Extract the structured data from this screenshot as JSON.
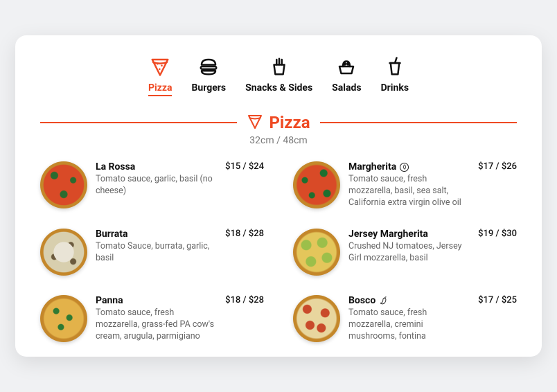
{
  "accent": "#ef4a23",
  "categories": [
    {
      "id": "pizza",
      "label": "Pizza",
      "active": true
    },
    {
      "id": "burgers",
      "label": "Burgers",
      "active": false
    },
    {
      "id": "snacks",
      "label": "Snacks & Sides",
      "active": false
    },
    {
      "id": "salads",
      "label": "Salads",
      "active": false
    },
    {
      "id": "drinks",
      "label": "Drinks",
      "active": false
    }
  ],
  "section": {
    "title": "Pizza",
    "subtitle": "32cm / 48cm"
  },
  "items": [
    {
      "name": "La Rossa",
      "desc": "Tomato sauce, garlic, basil (no cheese)",
      "price": "$15 / $24",
      "tag": null,
      "thumb": "pz-rossa"
    },
    {
      "name": "Margherita",
      "desc": "Tomato sauce, fresh mozzarella, basil, sea salt, California extra virgin olive oil",
      "price": "$17 / $26",
      "tag": "veg",
      "thumb": "pz-margh"
    },
    {
      "name": "Burrata",
      "desc": "Tomato Sauce, burrata, garlic, basil",
      "price": "$18 / $28",
      "tag": null,
      "thumb": "pz-burrata"
    },
    {
      "name": "Jersey Margherita",
      "desc": "Crushed NJ tomatoes, Jersey Girl mozzarella, basil",
      "price": "$19 / $30",
      "tag": null,
      "thumb": "pz-jersey"
    },
    {
      "name": "Panna",
      "desc": "Tomato sauce, fresh mozzarella, grass-fed PA cow's cream, arugula, parmigiano",
      "price": "$18 / $28",
      "tag": null,
      "thumb": "pz-panna"
    },
    {
      "name": "Bosco",
      "desc": "Tomato sauce, fresh mozzarella, cremini mushrooms, fontina",
      "price": "$17 / $25",
      "tag": "spicy",
      "thumb": "pz-bosco"
    }
  ]
}
